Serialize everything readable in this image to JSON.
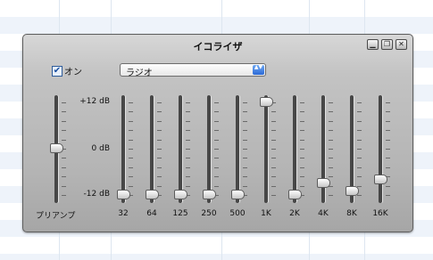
{
  "window": {
    "title": "イコライザ",
    "buttons": [
      {
        "name": "minimize-icon",
        "glyph": "▁"
      },
      {
        "name": "zoom-icon",
        "glyph": "❐"
      },
      {
        "name": "close-icon",
        "glyph": "✕"
      }
    ]
  },
  "enable": {
    "label": "オン",
    "checked": true,
    "check_glyph": "✔"
  },
  "preset": {
    "value": "ラジオ",
    "arrow_glyph": "▲▼"
  },
  "scale": {
    "max_label": "+12 dB",
    "mid_label": "0 dB",
    "min_label": "-12 dB",
    "max_db": 12,
    "min_db": -12
  },
  "preamp": {
    "label": "プリアンプ",
    "gain_db": 0
  },
  "bands": [
    {
      "label": "32",
      "gain_db": -12
    },
    {
      "label": "64",
      "gain_db": -12
    },
    {
      "label": "125",
      "gain_db": -12
    },
    {
      "label": "250",
      "gain_db": -12
    },
    {
      "label": "500",
      "gain_db": -12
    },
    {
      "label": "1K",
      "gain_db": 12
    },
    {
      "label": "2K",
      "gain_db": -12
    },
    {
      "label": "4K",
      "gain_db": -9
    },
    {
      "label": "8K",
      "gain_db": -11
    },
    {
      "label": "16K",
      "gain_db": -8
    }
  ]
}
